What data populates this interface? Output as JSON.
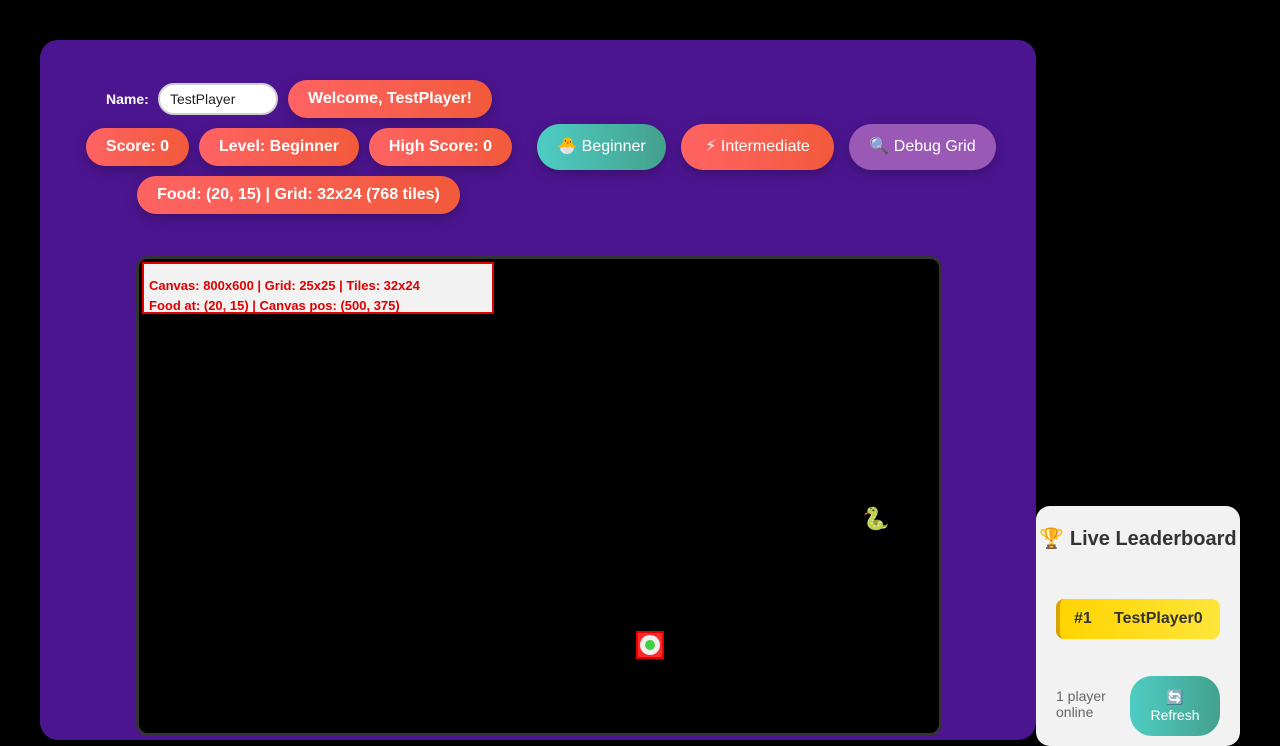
{
  "player": {
    "name_label": "Name:",
    "name_value": "TestPlayer",
    "welcome": "Welcome, TestPlayer!"
  },
  "stats": {
    "score": "Score: 0",
    "level": "Level: Beginner",
    "high_score": "High Score: 0",
    "food_grid": "Food: (20, 15) | Grid: 32x24 (768 tiles)"
  },
  "controls": {
    "beginner_icon": "🐣",
    "beginner_label": "Beginner",
    "intermediate_icon": "⚡",
    "intermediate_label": "Intermediate",
    "debug_icon": "🔍",
    "debug_label": "Debug Grid"
  },
  "debug_overlay": {
    "line1": "Canvas: 800x600 | Grid: 25x25 | Tiles: 32x24",
    "line2": "Food at: (20, 15) | Canvas pos: (500, 375)"
  },
  "game": {
    "snake_icon": "🐍",
    "food_icon": "food-apple-icon"
  },
  "leaderboard": {
    "title_icon": "🏆",
    "title": "Live Leaderboard",
    "entries": [
      {
        "rank": "#1",
        "name": "TestPlayer0"
      }
    ],
    "online": "1 player online",
    "refresh_icon": "🔄",
    "refresh_label": "Refresh"
  },
  "colors": {
    "panel_bg": "#4c1590",
    "accent_orange": "#f25a3b",
    "accent_teal": "#4ecdc4",
    "accent_purple": "#9b59b6",
    "debug_red": "#e00000",
    "leaderboard_gold": "#ffd400"
  }
}
